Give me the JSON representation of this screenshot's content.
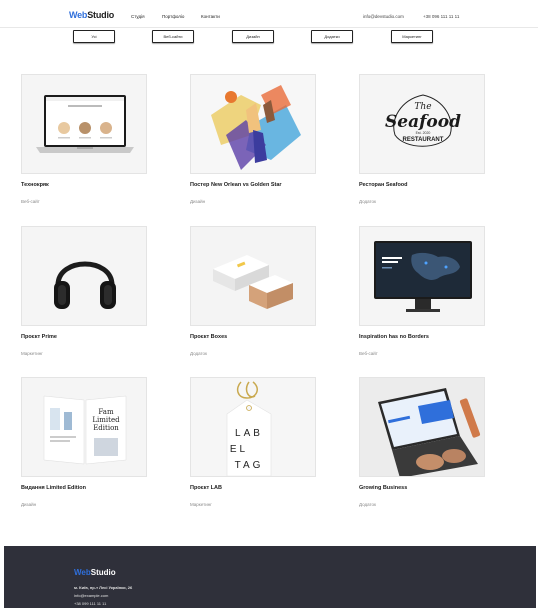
{
  "header": {
    "logo_web": "Web",
    "logo_studio": "Studio",
    "nav": [
      "Студія",
      "Портфоліо",
      "Контакти"
    ],
    "email": "info@devstudio.com",
    "phone": "+38 096 111 11 11"
  },
  "filters": [
    "Усі",
    "Веб-сайти",
    "Дизайн",
    "Додатки",
    "Маркетинг"
  ],
  "cards": [
    {
      "title": "Технокряк",
      "category": "Веб-сайт"
    },
    {
      "title": "Постер New Orlean vs Golden Star",
      "category": "Дизайн"
    },
    {
      "title": "Ресторан Seafood",
      "category": "Додаток"
    },
    {
      "title": "Проєкт Prime",
      "category": "Маркетинг"
    },
    {
      "title": "Проєкт Boxes",
      "category": "Додаток"
    },
    {
      "title": "Inspiration has no Borders",
      "category": "Веб-сайт"
    },
    {
      "title": "Видання Limited Edition",
      "category": "Дизайн"
    },
    {
      "title": "Проєкт LAB",
      "category": "Маркетинг"
    },
    {
      "title": "Growing Business",
      "category": "Додаток"
    }
  ],
  "artwork": {
    "seafood_the": "The",
    "seafood_name": "Seafood",
    "seafood_est": "Est. 2020",
    "seafood_sub": "RESTAURANT",
    "fam_line1": "Fam",
    "fam_line2": "Limited",
    "fam_line3": "Edition",
    "tag_line1": "LAB",
    "tag_line2": "EL",
    "tag_line3": "TAG"
  },
  "footer": {
    "logo_web": "Web",
    "logo_studio": "Studio",
    "address": "м. Київ, пр-т Лесі Українки, 26",
    "email": "info@example.com",
    "phone": "+38 099 111 11 11"
  },
  "colors": {
    "accent": "#2f6fdb",
    "footer_bg": "#2f303a"
  }
}
